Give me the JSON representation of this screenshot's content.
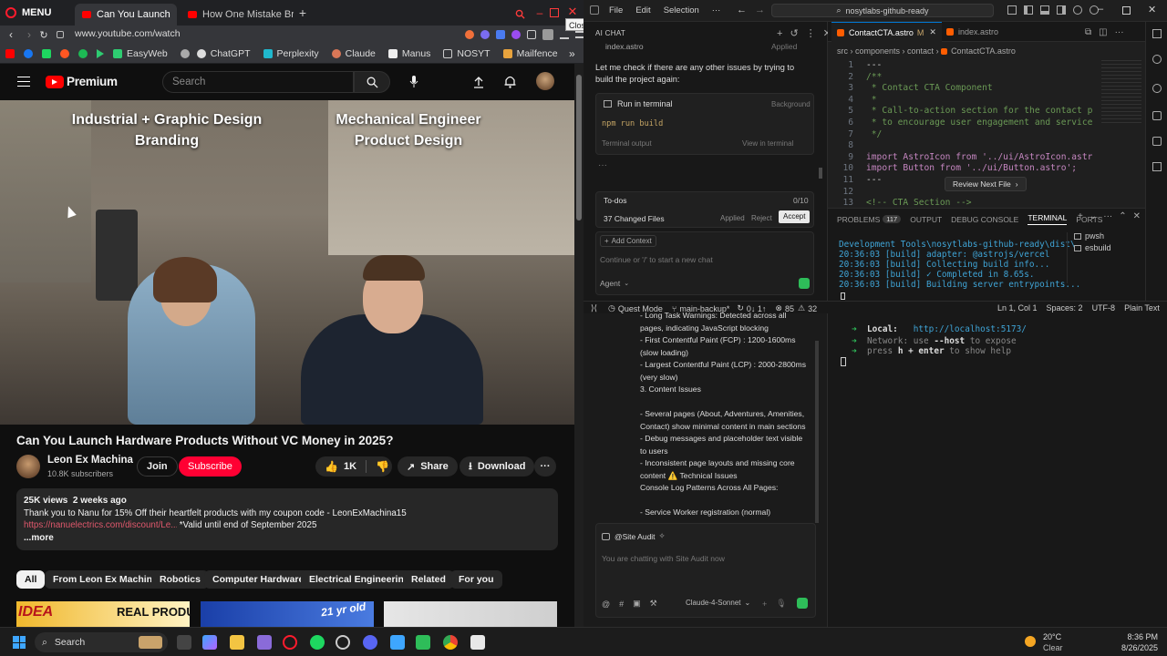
{
  "browser": {
    "menu_label": "MENU",
    "tabs": [
      {
        "title": "Can You Launch Hard",
        "active": true
      },
      {
        "title": "How One Mistake Broke C",
        "active": false
      }
    ],
    "close_tooltip": "Close",
    "url": "www.youtube.com/watch",
    "bookmarks": [
      "EasyWeb",
      "ChatGPT",
      "Perplexity",
      "Claude",
      "Manus",
      "NOSYT",
      "Mailfence"
    ]
  },
  "youtube": {
    "logo_text": "Premium",
    "search_placeholder": "Search",
    "video_overlay": {
      "left": "Industrial + Graphic Design\nBranding",
      "right": "Mechanical Engineer\nProduct Design"
    },
    "title": "Can You Launch Hardware Products Without VC Money in 2025?",
    "channel": "Leon Ex Machina",
    "subscribers": "10.8K subscribers",
    "join_label": "Join",
    "subscribe_label": "Subscribe",
    "likes": "1K",
    "share_label": "Share",
    "download_label": "Download",
    "views_date": "25K views  2 weeks ago",
    "description_line1": "Thank you to Nanu for 15% Off their heartfelt products with my coupon code - LeonExMachina15",
    "description_link": "https://nanuelectrics.com/discount/Le...",
    "description_tail": " *Valid until end of September 2025",
    "more_label": "...more",
    "chips": [
      "All",
      "From Leon Ex Machina",
      "Robotics",
      "Computer Hardware",
      "Electrical Engineering",
      "Related",
      "For you"
    ],
    "thumb_texts": [
      "IDEA",
      "REAL PRODUCT!",
      "21 yr old"
    ]
  },
  "editor": {
    "menus": [
      "File",
      "Edit",
      "Selection",
      "···"
    ],
    "command_center": "nosytlabs-github-ready",
    "chat": {
      "header": "AI CHAT",
      "applied_file": "index.astro",
      "applied_label": "Applied",
      "message": "Let me check if there are any other issues by trying to build the project again:",
      "run_label": "Run in terminal",
      "run_badge": "Background",
      "command": "npm run build",
      "terminal_output": "Terminal output",
      "view_in_terminal": "View in terminal",
      "ellipsis": "···",
      "todos_label": "To-dos",
      "todos_count": "0/10",
      "changed_files": "37 Changed Files",
      "applied": "Applied",
      "reject": "Reject",
      "accept": "Accept",
      "add_context": "Add Context",
      "input_placeholder": "Continue or '/' to start a new chat",
      "agent_label": "Agent"
    },
    "code_tabs": [
      {
        "name": "ContactCTA.astro",
        "badge": "M",
        "active": true
      },
      {
        "name": "index.astro",
        "badge": "",
        "active": false
      }
    ],
    "breadcrumb": [
      "src",
      "components",
      "contact",
      "ContactCTA.astro"
    ],
    "code_lines": [
      {
        "n": "1",
        "t": "---"
      },
      {
        "n": "2",
        "t": "/**"
      },
      {
        "n": "3",
        "t": " * Contact CTA Component"
      },
      {
        "n": "4",
        "t": " *"
      },
      {
        "n": "5",
        "t": " * Call-to-action section for the contact page wi"
      },
      {
        "n": "6",
        "t": " * to encourage user engagement and service explo"
      },
      {
        "n": "7",
        "t": " */"
      },
      {
        "n": "8",
        "t": ""
      },
      {
        "n": "9",
        "t": "import AstroIcon from '../ui/AstroIcon.astro';"
      },
      {
        "n": "10",
        "t": "import Button from '../ui/Button.astro';"
      },
      {
        "n": "11",
        "t": "---"
      },
      {
        "n": "12",
        "t": ""
      },
      {
        "n": "13",
        "t": "<!-- CTA Section -->"
      }
    ],
    "review_next": "Review Next File",
    "panel_tabs": [
      "PROBLEMS",
      "OUTPUT",
      "DEBUG CONSOLE",
      "TERMINAL",
      "PORTS"
    ],
    "problems_count": "117",
    "terminal_lines": [
      "Development Tools\\nosytlabs-github-ready\\dist\\",
      "20:36:03 [build] adapter: @astrojs/vercel",
      "20:36:03 [build] Collecting build info...",
      "20:36:03 [build] ✓ Completed in 8.65s.",
      "20:36:03 [build] Building server entrypoints..."
    ],
    "terminal_sessions": [
      "pwsh",
      "esbuild"
    ],
    "status": {
      "mode": "Quest Mode",
      "branch": "main-backup*",
      "sync": "0↓ 1↑",
      "errors": "85",
      "warnings": "32",
      "position": "Ln 1, Col 1",
      "spaces": "Spaces: 2",
      "encoding": "UTF-8",
      "language": "Plain Text"
    },
    "audit_lines": [
      "- Long Task Warnings: Detected across all",
      "pages, indicating JavaScript blocking",
      "- First Contentful Paint (FCP) : 1200-1600ms",
      "(slow loading)",
      "- Largest Contentful Paint (LCP) : 2000-2800ms",
      "(very slow)",
      "3. Content Issues",
      "",
      "- Several pages (About, Adventures, Amenities,",
      "Contact) show minimal content in main sections",
      "- Debug messages and placeholder text visible",
      "to users",
      "- Inconsistent page layouts and missing core",
      "content ⚠️ Technical Issues",
      "Console Log Patterns Across All Pages:",
      "",
      "- Service Worker registration (normal)"
    ],
    "site_audit_title": "@Site Audit",
    "audit_placeholder": "You are chatting with Site Audit now",
    "model": "Claude-4-Sonnet",
    "vite": {
      "local_label": "Local:",
      "local_url": "http://localhost:5173/",
      "network_prefix": "Network: use ",
      "network_flag": "--host",
      "network_suffix": " to expose",
      "help_prefix": "press ",
      "help_key": "h + enter",
      "help_suffix": " to show help"
    }
  },
  "taskbar": {
    "search_label": "Search",
    "weather_temp": "20°C",
    "weather_desc": "Clear",
    "time": "8:36 PM",
    "date": "8/26/2025"
  }
}
